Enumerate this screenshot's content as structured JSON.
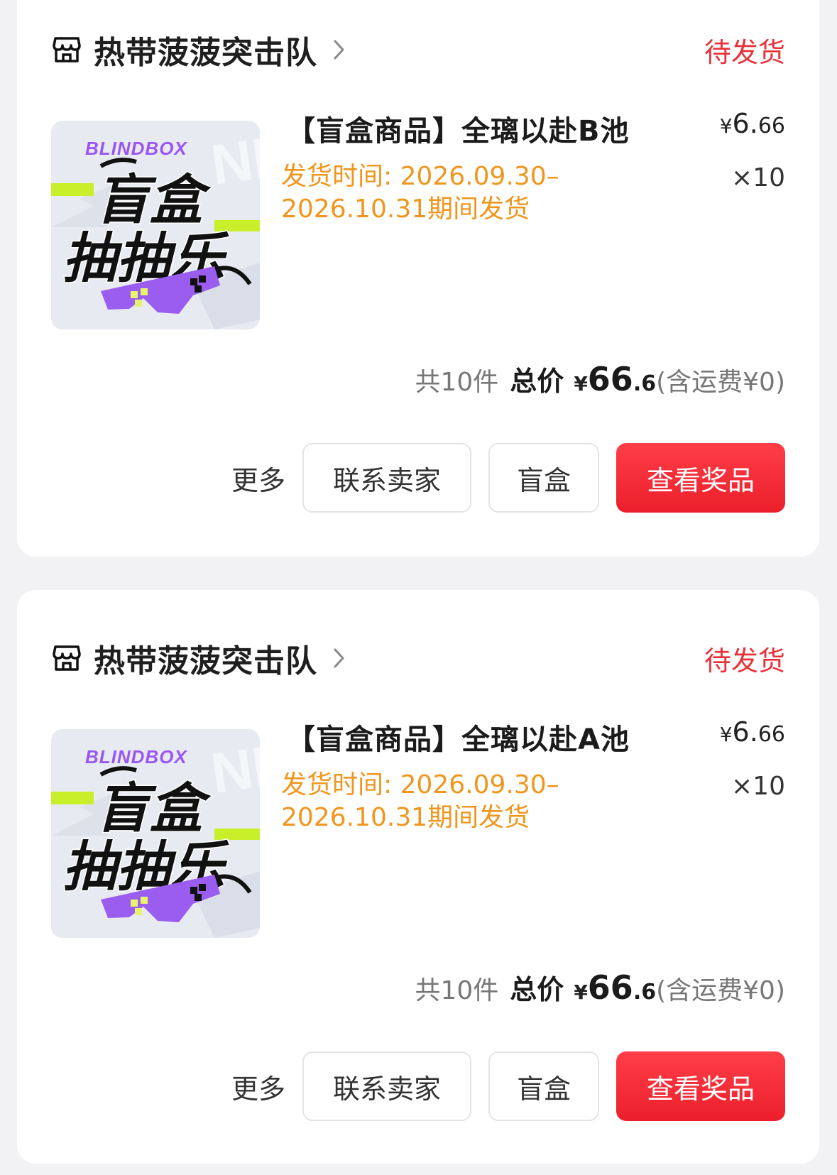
{
  "orders": [
    {
      "shop_name": "热带菠菠突击队",
      "status": "待发货",
      "item": {
        "title": "【盲盒商品】全璃以赴B池",
        "ship_time": "发货时间: 2026.09.30–2026.10.31期间发货",
        "price_symbol": "¥",
        "price_int": "6.",
        "price_dec": "66",
        "qty": "×10",
        "image": {
          "brand": "BLINDBOX",
          "line1": "盲盒",
          "line2": "抽抽乐"
        }
      },
      "total": {
        "count": "共10件",
        "label": "总价",
        "symbol": "¥",
        "amount_int": "66",
        "amount_dec": ".6",
        "shipping": "(含运费¥0)"
      },
      "actions": {
        "more": "更多",
        "contact": "联系卖家",
        "box": "盲盒",
        "primary": "查看奖品"
      }
    },
    {
      "shop_name": "热带菠菠突击队",
      "status": "待发货",
      "item": {
        "title": "【盲盒商品】全璃以赴A池",
        "ship_time": "发货时间: 2026.09.30–2026.10.31期间发货",
        "price_symbol": "¥",
        "price_int": "6.",
        "price_dec": "66",
        "qty": "×10",
        "image": {
          "brand": "BLINDBOX",
          "line1": "盲盒",
          "line2": "抽抽乐"
        }
      },
      "total": {
        "count": "共10件",
        "label": "总价",
        "symbol": "¥",
        "amount_int": "66",
        "amount_dec": ".6",
        "shipping": "(含运费¥0)"
      },
      "actions": {
        "more": "更多",
        "contact": "联系卖家",
        "box": "盲盒",
        "primary": "查看奖品"
      }
    }
  ],
  "colors": {
    "status_red": "#e8323a",
    "ship_orange": "#f0961e",
    "primary_button": "#ee2530",
    "page_bg": "#f2f2f4"
  }
}
